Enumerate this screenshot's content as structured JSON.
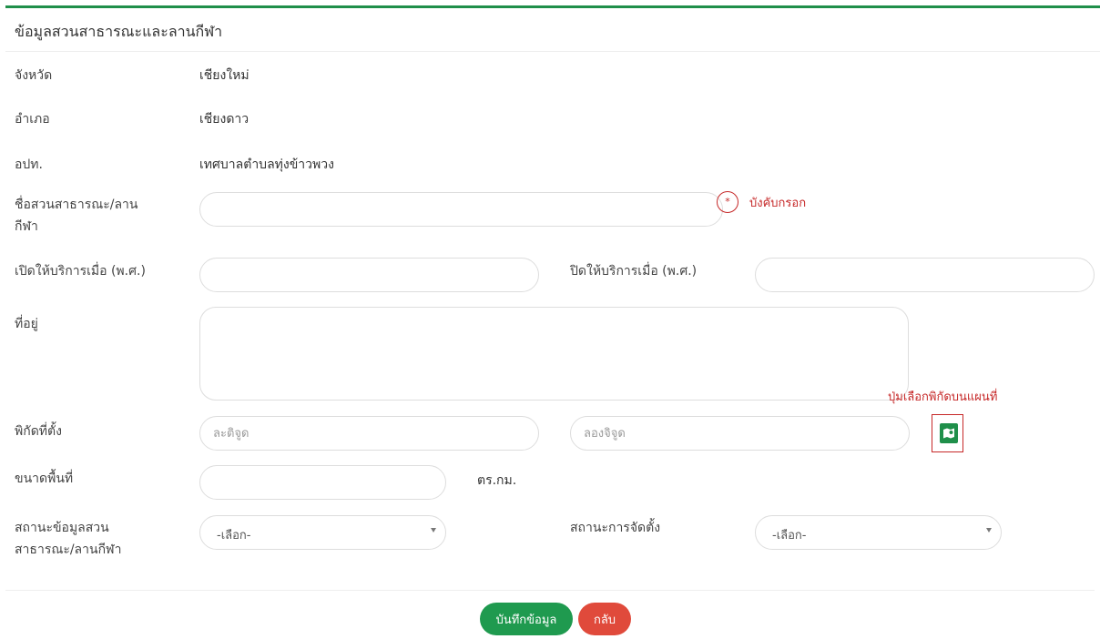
{
  "header": {
    "title": "ข้อมูลสวนสาธารณะและลานกีฬา"
  },
  "fields": {
    "province": {
      "label": "จังหวัด",
      "value": "เชียงใหม่"
    },
    "district": {
      "label": "อำเภอ",
      "value": "เชียงดาว"
    },
    "lao": {
      "label": "อปท.",
      "value": "เทศบาลตำบลทุ่งข้าวพวง"
    },
    "park_name": {
      "label_line1": "ชื่อสวนสาธารณะ/ลาน",
      "label_line2": "กีฬา",
      "value": "",
      "required_text": "บังคับกรอก",
      "required_icon": "*"
    },
    "open_year": {
      "label": "เปิดให้บริการเมื่อ (พ.ศ.)",
      "value": ""
    },
    "close_year": {
      "label": "ปิดให้บริการเมื่อ (พ.ศ.)",
      "value": ""
    },
    "address": {
      "label": "ที่อยู่",
      "value": ""
    },
    "coordinates": {
      "label": "พิกัดที่ตั้ง",
      "lat_placeholder": "ละติจูด",
      "lng_placeholder": "ลองจิจูด",
      "map_hint": "ปุ่มเลือกพิกัดบนแผนที่",
      "map_icon": "map-icon"
    },
    "area": {
      "label": "ขนาดพื้นที่",
      "value": "",
      "unit": "ตร.กม."
    },
    "data_status": {
      "label_line1": "สถานะข้อมูลสวน",
      "label_line2": "สาธารณะ/ลานกีฬา",
      "selected": "-เลือก-"
    },
    "establish_status": {
      "label": "สถานะการจัดตั้ง",
      "selected": "-เลือก-"
    }
  },
  "actions": {
    "save": "บันทึกข้อมูล",
    "back": "กลับ"
  },
  "colors": {
    "accent": "#1f8f4a",
    "danger": "#e04a3b",
    "required": "#c62828"
  }
}
